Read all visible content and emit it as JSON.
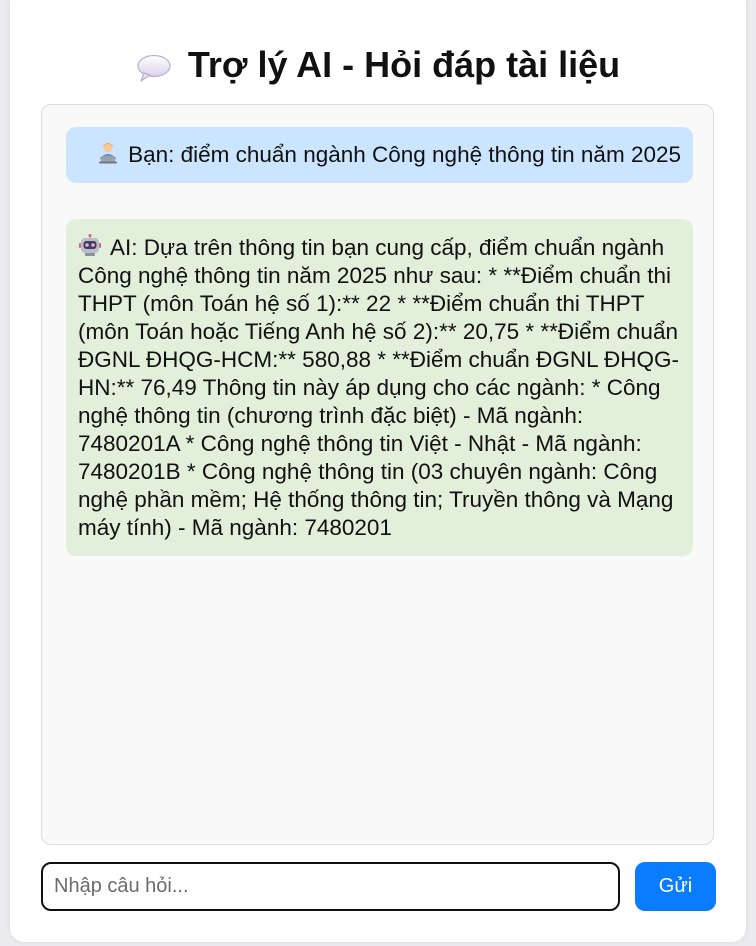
{
  "header": {
    "title": "Trợ lý AI - Hỏi đáp tài liệu",
    "icon": "speech-bubble-icon"
  },
  "chat": {
    "messages": [
      {
        "role": "user",
        "icon": "person-laptop-icon",
        "text": "Bạn: điểm chuẩn ngành Công nghệ thông tin năm 2025"
      },
      {
        "role": "ai",
        "icon": "robot-icon",
        "text": "AI: Dựa trên thông tin bạn cung cấp, điểm chuẩn ngành Công nghệ thông tin năm 2025 như sau: * **Điểm chuẩn thi THPT (môn Toán hệ số 1):** 22 * **Điểm chuẩn thi THPT (môn Toán hoặc Tiếng Anh hệ số 2):** 20,75 * **Điểm chuẩn ĐGNL ĐHQG-HCM:** 580,88 * **Điểm chuẩn ĐGNL ĐHQG-HN:** 76,49 Thông tin này áp dụng cho các ngành: * Công nghệ thông tin (chương trình đặc biệt) - Mã ngành: 7480201A * Công nghệ thông tin Việt - Nhật - Mã ngành: 7480201B * Công nghệ thông tin (03 chuyên ngành: Công nghệ phần mềm; Hệ thống thông tin; Truyền thông và Mạng máy tính) - Mã ngành: 7480201"
      }
    ]
  },
  "composer": {
    "placeholder": "Nhập câu hỏi...",
    "value": "",
    "send_label": "Gửi"
  },
  "colors": {
    "user_bubble": "#cce5ff",
    "ai_bubble": "#e2efda",
    "send_button": "#0a7cff"
  }
}
